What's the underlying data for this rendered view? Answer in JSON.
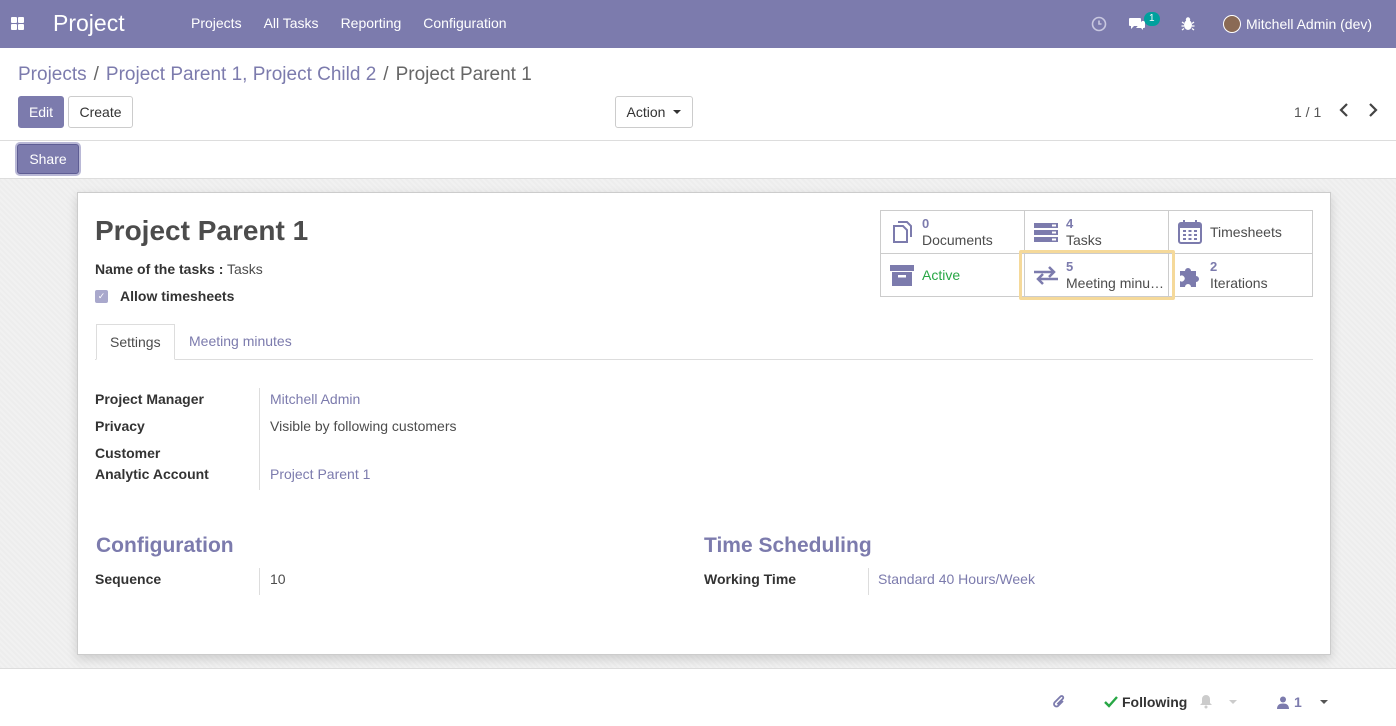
{
  "navbar": {
    "brand": "Project",
    "menu": [
      "Projects",
      "All Tasks",
      "Reporting",
      "Configuration"
    ],
    "messages_badge": "1",
    "user": "Mitchell Admin (dev)"
  },
  "breadcrumb": {
    "items": [
      "Projects",
      "Project Parent 1, Project Child 2",
      "Project Parent 1"
    ],
    "separator": "/"
  },
  "buttons": {
    "edit": "Edit",
    "create": "Create",
    "action": "Action",
    "share": "Share"
  },
  "pager": {
    "value": "1 / 1"
  },
  "smart_buttons": {
    "documents": {
      "count": "0",
      "label": "Documents"
    },
    "tasks": {
      "count": "4",
      "label": "Tasks"
    },
    "timesheets": {
      "label": "Timesheets"
    },
    "active": {
      "label": "Active"
    },
    "meeting_minutes": {
      "count": "5",
      "label": "Meeting minu…"
    },
    "iterations": {
      "count": "2",
      "label": "Iterations"
    }
  },
  "record": {
    "title": "Project Parent 1",
    "tasks_name_label": "Name of the tasks :",
    "tasks_name_value": "Tasks",
    "allow_timesheets_label": "Allow timesheets"
  },
  "tabs": [
    "Settings",
    "Meeting minutes"
  ],
  "settings": {
    "project_manager_label": "Project Manager",
    "project_manager_value": "Mitchell Admin",
    "privacy_label": "Privacy",
    "privacy_value": "Visible by following customers",
    "customer_label": "Customer",
    "analytic_label": "Analytic Account",
    "analytic_value": "Project Parent 1"
  },
  "configuration": {
    "title": "Configuration",
    "sequence_label": "Sequence",
    "sequence_value": "10"
  },
  "time_scheduling": {
    "title": "Time Scheduling",
    "working_time_label": "Working Time",
    "working_time_value": "Standard 40 Hours/Week"
  },
  "chatter": {
    "following": "Following",
    "followers_count": "1"
  },
  "colors": {
    "brand": "#7c7bad",
    "active": "#28a745",
    "badge": "#00a09d",
    "highlight": "#f5d99a"
  }
}
